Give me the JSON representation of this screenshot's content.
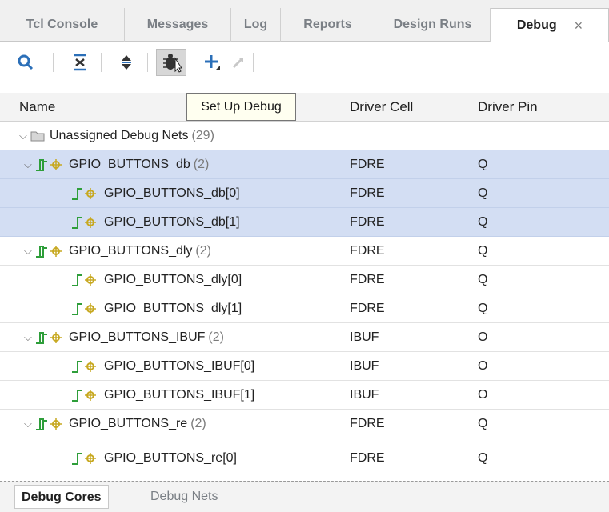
{
  "tabs": [
    {
      "label": "Tcl Console"
    },
    {
      "label": "Messages"
    },
    {
      "label": "Log"
    },
    {
      "label": "Reports"
    },
    {
      "label": "Design Runs"
    },
    {
      "label": "Debug",
      "close": "×"
    }
  ],
  "toolbar": {
    "tooltip": "Set Up Debug",
    "icons": [
      "search-icon",
      "collapse-all-icon",
      "expand-all-icon",
      "set-up-debug-icon",
      "add-icon",
      "remove-icon"
    ]
  },
  "columns": {
    "name": "Name",
    "driver_cell": "Driver Cell",
    "driver_pin": "Driver Pin"
  },
  "tree": {
    "group_label": "Unassigned Debug Nets",
    "group_count": "(29)",
    "rows": [
      {
        "name": "GPIO_BUTTONS_db",
        "count": "(2)",
        "cell": "FDRE",
        "pin": "Q"
      },
      {
        "name": "GPIO_BUTTONS_db[0]",
        "cell": "FDRE",
        "pin": "Q"
      },
      {
        "name": "GPIO_BUTTONS_db[1]",
        "cell": "FDRE",
        "pin": "Q"
      },
      {
        "name": "GPIO_BUTTONS_dly",
        "count": "(2)",
        "cell": "FDRE",
        "pin": "Q"
      },
      {
        "name": "GPIO_BUTTONS_dly[0]",
        "cell": "FDRE",
        "pin": "Q"
      },
      {
        "name": "GPIO_BUTTONS_dly[1]",
        "cell": "FDRE",
        "pin": "Q"
      },
      {
        "name": "GPIO_BUTTONS_IBUF",
        "count": "(2)",
        "cell": "IBUF",
        "pin": "O"
      },
      {
        "name": "GPIO_BUTTONS_IBUF[0]",
        "cell": "IBUF",
        "pin": "O"
      },
      {
        "name": "GPIO_BUTTONS_IBUF[1]",
        "cell": "IBUF",
        "pin": "O"
      },
      {
        "name": "GPIO_BUTTONS_re",
        "count": "(2)",
        "cell": "FDRE",
        "pin": "Q"
      },
      {
        "name": "GPIO_BUTTONS_re[0]",
        "cell": "FDRE",
        "pin": "Q"
      }
    ]
  },
  "bottom_tabs": [
    {
      "label": "Debug Cores"
    },
    {
      "label": "Debug Nets"
    }
  ],
  "colors": {
    "selection": "#d3def3",
    "icon_green": "#2e9e3a"
  }
}
